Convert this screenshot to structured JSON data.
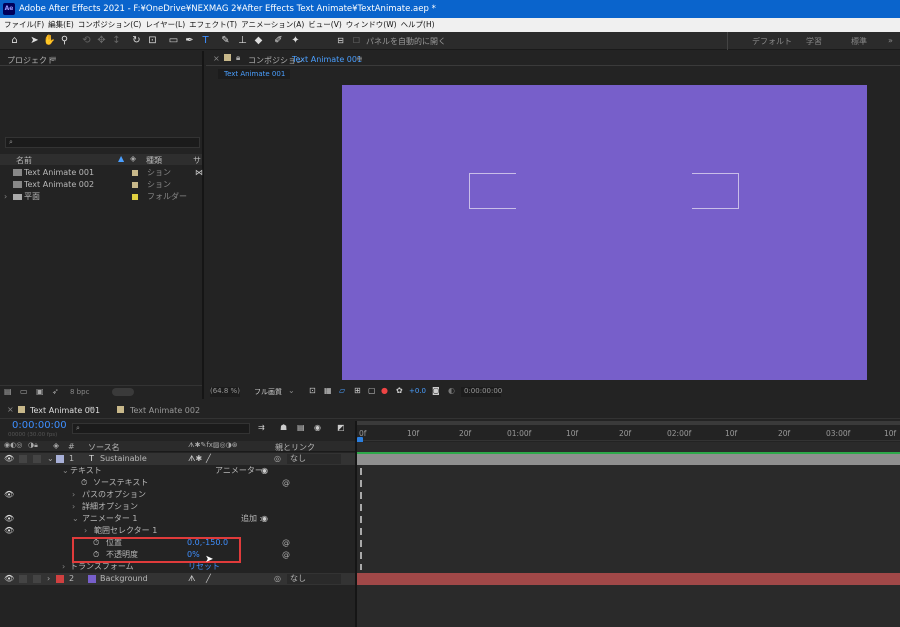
{
  "window": {
    "app_badge": "Ae",
    "title": "Adobe After Effects 2021 - F:¥OneDrive¥NEXMAG 2¥After Effects Text Animate¥TextAnimate.aep *"
  },
  "menu": [
    "ファイル(F)",
    "編集(E)",
    "コンポジション(C)",
    "レイヤー(L)",
    "エフェクト(T)",
    "アニメーション(A)",
    "ビュー(V)",
    "ウィンドウ(W)",
    "ヘルプ(H)"
  ],
  "toolbar": {
    "auto_open_label": "パネルを自動的に開く",
    "workspaces": [
      "デフォルト",
      "学習",
      "標準"
    ],
    "overflow": "»"
  },
  "project": {
    "title": "プロジェクト",
    "search_placeholder": "⌕",
    "col_name": "名前",
    "col_type": "種類",
    "col_extra": "サ",
    "items": [
      {
        "name": "Text Animate 001",
        "type": "ション",
        "color": "#c8b88a",
        "icon": "composition-icon"
      },
      {
        "name": "Text Animate 002",
        "type": "ション",
        "color": "#c8b88a",
        "icon": "composition-icon"
      },
      {
        "name": "平面",
        "type": "フォルダー",
        "color": "#e0d040",
        "icon": "folder-icon"
      }
    ],
    "footer": {
      "bpc": "8 bpc"
    }
  },
  "comp_viewer": {
    "title": "コンポジション",
    "comp_name": "Text Animate 001",
    "tab": "Text Animate 001",
    "canvas_color": "#775fca",
    "footer": {
      "zoom": "(64.8 %)",
      "resolution": "フル画質",
      "exposure": "+0.0",
      "timecode": "0:00:00:00"
    }
  },
  "timeline": {
    "tabs": [
      {
        "label": "Text Animate 001",
        "color": "#c8b88a"
      },
      {
        "label": "Text Animate 002",
        "color": "#c8b88a"
      }
    ],
    "timecode": "0:00:00:00",
    "frame_info": "00000 (30.00 fps)",
    "search_placeholder": "⌕",
    "col_layer_name": "ソース名",
    "col_parent": "親とリンク",
    "ruler": [
      "0f",
      "10f",
      "20f",
      "01:00f",
      "10f",
      "20f",
      "02:00f",
      "10f",
      "20f",
      "03:00f",
      "10f"
    ],
    "layers": [
      {
        "num": "1",
        "type": "T",
        "name": "Sustainable",
        "parent": "なし",
        "label_color": "#a8b0d8"
      },
      {
        "prop": "テキスト",
        "right": "アニメーター :"
      },
      {
        "prop": "ソーステキスト"
      },
      {
        "prop": "パスのオプション"
      },
      {
        "prop": "詳細オプション"
      },
      {
        "prop": "アニメーター 1",
        "right": "追加 :"
      },
      {
        "prop": "範囲セレクター 1"
      },
      {
        "prop": "位置",
        "value": "0.0,-150.0"
      },
      {
        "prop": "不透明度",
        "value": "0%"
      },
      {
        "prop": "トランスフォーム",
        "right": "リセット"
      },
      {
        "num": "2",
        "name": "Background",
        "parent": "なし",
        "label_color": "#d04040"
      }
    ]
  }
}
